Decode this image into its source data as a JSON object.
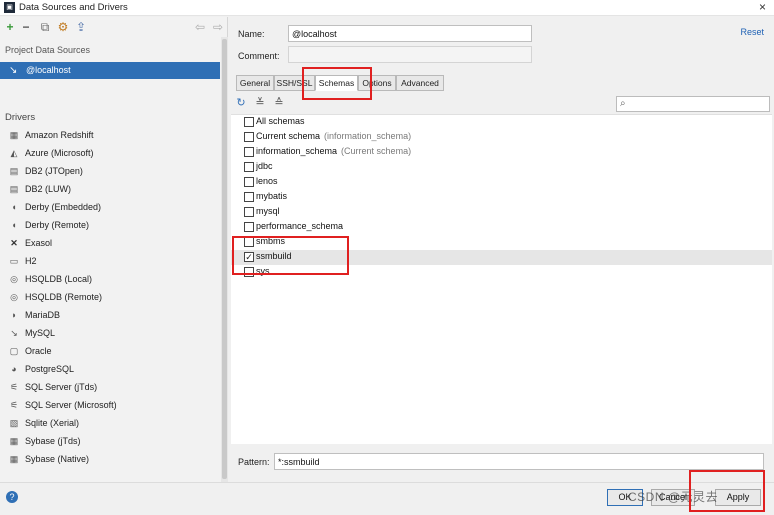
{
  "window": {
    "title": "Data Sources and Drivers",
    "close_glyph": "×"
  },
  "left": {
    "project_label": "Project Data Sources",
    "data_source": "@localhost",
    "drivers_label": "Drivers",
    "drivers": [
      {
        "label": "Amazon Redshift",
        "icon": "database-icon"
      },
      {
        "label": "Azure (Microsoft)",
        "icon": "azure-icon"
      },
      {
        "label": "DB2 (JTOpen)",
        "icon": "db2-icon"
      },
      {
        "label": "DB2 (LUW)",
        "icon": "db2-icon"
      },
      {
        "label": "Derby (Embedded)",
        "icon": "derby-icon"
      },
      {
        "label": "Derby (Remote)",
        "icon": "derby-icon"
      },
      {
        "label": "Exasol",
        "icon": "exasol-icon"
      },
      {
        "label": "H2",
        "icon": "h2-icon"
      },
      {
        "label": "HSQLDB (Local)",
        "icon": "hsqldb-icon"
      },
      {
        "label": "HSQLDB (Remote)",
        "icon": "hsqldb-icon"
      },
      {
        "label": "MariaDB",
        "icon": "mariadb-icon"
      },
      {
        "label": "MySQL",
        "icon": "mysql-icon"
      },
      {
        "label": "Oracle",
        "icon": "oracle-icon"
      },
      {
        "label": "PostgreSQL",
        "icon": "postgresql-icon"
      },
      {
        "label": "SQL Server (jTds)",
        "icon": "sqlserver-icon"
      },
      {
        "label": "SQL Server (Microsoft)",
        "icon": "sqlserver-icon"
      },
      {
        "label": "Sqlite (Xerial)",
        "icon": "sqlite-icon"
      },
      {
        "label": "Sybase (jTds)",
        "icon": "sybase-icon"
      },
      {
        "label": "Sybase (Native)",
        "icon": "sybase-icon"
      }
    ]
  },
  "right": {
    "name_label": "Name:",
    "name_value": "@localhost",
    "comment_label": "Comment:",
    "comment_value": "",
    "reset_label": "Reset",
    "tabs": [
      "General",
      "SSH/SSL",
      "Schemas",
      "Options",
      "Advanced"
    ],
    "active_tab": "Schemas",
    "schemas": [
      {
        "name": "All schemas",
        "hint": "",
        "checked": false
      },
      {
        "name": "Current schema",
        "hint": "(information_schema)",
        "checked": false
      },
      {
        "name": "information_schema",
        "hint": "(Current schema)",
        "checked": false
      },
      {
        "name": "jdbc",
        "hint": "",
        "checked": false
      },
      {
        "name": "lenos",
        "hint": "",
        "checked": false
      },
      {
        "name": "mybatis",
        "hint": "",
        "checked": false
      },
      {
        "name": "mysql",
        "hint": "",
        "checked": false
      },
      {
        "name": "performance_schema",
        "hint": "",
        "checked": false
      },
      {
        "name": "smbms",
        "hint": "",
        "checked": false
      },
      {
        "name": "ssmbuild",
        "hint": "",
        "checked": true
      },
      {
        "name": "sys",
        "hint": "",
        "checked": false
      }
    ],
    "pattern_label": "Pattern:",
    "pattern_value": "*:ssmbuild"
  },
  "bottom": {
    "help": "?",
    "ok_label": "OK",
    "cancel_label": "Cancel",
    "apply_label": "Apply",
    "watermark": "CSDN @元灵去"
  },
  "colors": {
    "selection": "#2f6fb5",
    "highlight": "#e02020"
  }
}
